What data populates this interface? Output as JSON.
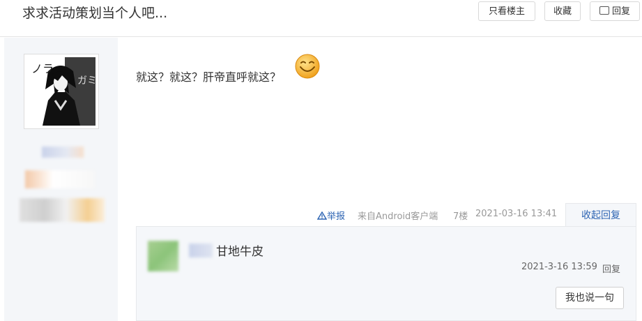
{
  "header": {
    "title": "求求活动策划当个人吧...",
    "only_op_label": "只看楼主",
    "favorite_label": "收藏",
    "reply_label": "回复"
  },
  "post": {
    "content": "就这？就这？肝帝直呼就这？",
    "emoji_icon": "smiley-emoji-icon",
    "report_label": "举报",
    "source": "来自Android客户端",
    "floor": "7楼",
    "time": "2021-03-16 13:41",
    "collapse_label": "收起回复"
  },
  "reply": {
    "text": "甘地牛皮",
    "time": "2021-3-16 13:59",
    "action_label": "回复",
    "say_button_label": "我也说一句"
  },
  "colors": {
    "link_blue": "#2d64b3",
    "sidebar_bg": "#f4f6f9",
    "reply_panel_bg": "#f5f7fa"
  }
}
